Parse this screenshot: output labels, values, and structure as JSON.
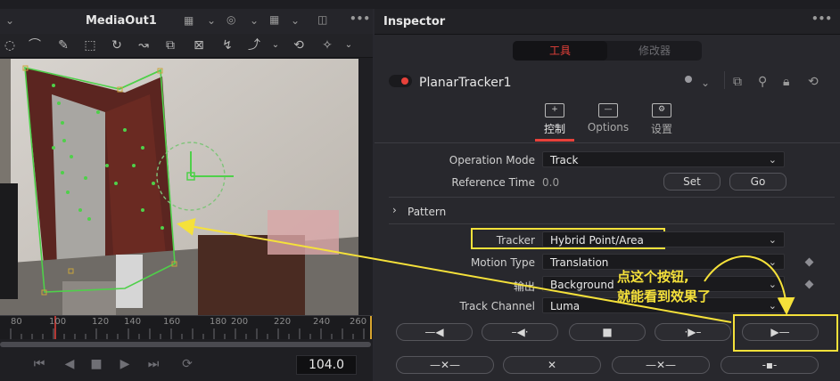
{
  "viewer": {
    "title": "MediaOut1",
    "timecode": "104.0",
    "ruler_ticks": [
      "80",
      "100",
      "120",
      "140",
      "160",
      "180",
      "200",
      "220",
      "240",
      "260"
    ],
    "playhead_frame": 100
  },
  "inspector": {
    "title": "Inspector",
    "segments": [
      "工具",
      "修改器"
    ],
    "node_name": "PlanarTracker1",
    "tabs": [
      "控制",
      "Options",
      "设置"
    ],
    "fields": {
      "operation_mode": {
        "label": "Operation Mode",
        "value": "Track"
      },
      "reference_time": {
        "label": "Reference Time",
        "value": "0.0",
        "set": "Set",
        "go": "Go"
      },
      "pattern": "Pattern",
      "tracker": {
        "label": "Tracker",
        "value": "Hybrid Point/Area"
      },
      "motion_type": {
        "label": "Motion Type",
        "value": "Translation"
      },
      "output": {
        "label": "输出",
        "value": "Background"
      },
      "track_channel": {
        "label": "Track Channel",
        "value": "Luma"
      }
    }
  },
  "annotation": {
    "line1": "点这个按钮,",
    "line2": "就能看到效果了"
  },
  "colors": {
    "accent_red": "#e8413a",
    "highlight_yellow": "#f5e13a",
    "tracker_green": "#4fd04a"
  }
}
